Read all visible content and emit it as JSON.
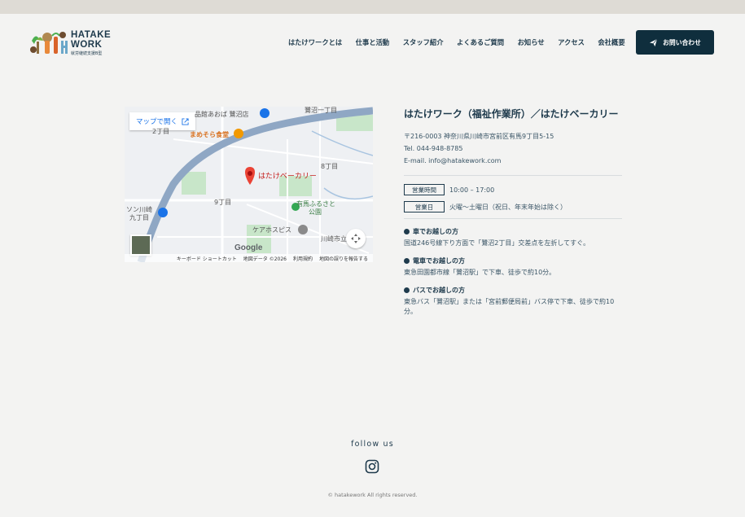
{
  "logo": {
    "line1": "HATAKE",
    "line2": "WORK",
    "sub": "就労継続支援B型"
  },
  "nav": [
    "はたけワークとは",
    "仕事と活動",
    "スタッフ紹介",
    "よくあるご質問",
    "お知らせ",
    "アクセス",
    "会社概要"
  ],
  "contact_label": "お問い合わせ",
  "map": {
    "open_label": "マップで開く",
    "marker_label": "はたけベーカリー",
    "labels": {
      "food": "品館あおば 鷺沼店",
      "restaurant": "まめそら食堂",
      "district1": "8丁目",
      "district2": "9丁目",
      "district3": "2丁目",
      "park1": "有馬ふるさと",
      "park2": "公園",
      "hospice": "ケアホスピス",
      "city": "川崎市立",
      "left1": "ソン川崎",
      "left2": "九丁目",
      "road": "鷺沼一丁目"
    },
    "google": "Google",
    "footer": [
      "キーボード ショートカット",
      "地図データ ©2026",
      "利用規約",
      "地図の誤りを報告する"
    ]
  },
  "info": {
    "title": "はたけワーク（福祉作業所）／はたけベーカリー",
    "postal": "〒216-0003 神奈川県川崎市宮前区有馬9丁目5-15",
    "tel": "Tel. 044-948-8785",
    "email": "E-mail. info@hatakework.com",
    "hours_label": "営業時間",
    "hours_value": "10:00 – 17:00",
    "days_label": "営業日",
    "days_value": "火曜〜土曜日（祝日、年末年始は除く）",
    "access": [
      {
        "heading": "車でお越しの方",
        "text": "国道246号線下り方面で「鷺沼2丁目」交差点を左折してすぐ。"
      },
      {
        "heading": "電車でお越しの方",
        "text": "東急田園都市線「鷺沼駅」で下車、徒歩で約10分。"
      },
      {
        "heading": "バスでお越しの方",
        "text": "東急バス「鷺沼駅」または「宮前郵便局前」バス停で下車、徒歩で約10分。"
      }
    ]
  },
  "follow_label": "follow us",
  "copyright": "© hatakework All rights reserved."
}
